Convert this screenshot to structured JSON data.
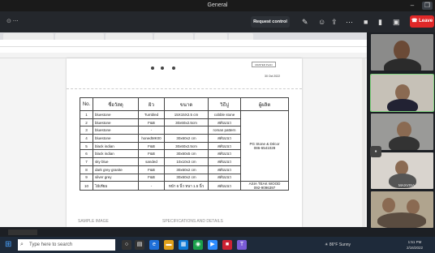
{
  "window": {
    "title": "General"
  },
  "meeting_bar": {
    "left_label": "",
    "request_control": "Request control",
    "leave": "Leave"
  },
  "browser": {
    "tabs": [
      "",
      "",
      "",
      "",
      "",
      ""
    ],
    "url": "",
    "bookmarks": ""
  },
  "pdf": {
    "zoom": "",
    "tools": "",
    "plan_mark": "MASTER PLAN",
    "stamp": "",
    "date": "30 Oct 2022",
    "footer_left": "SAMPLE IMAGE",
    "footer_right": "SPECIFICATIONS AND DETAILS"
  },
  "table": {
    "headers": [
      "No.",
      "ชื่อวัสดุ",
      "ผิว",
      "ขนาด",
      "วิธีปู",
      "ผู้ผลิต"
    ],
    "rows": [
      [
        "1",
        "bluestone",
        "Tumbled",
        "15X15X2.5 cm",
        "cobble stone"
      ],
      [
        "2",
        "bluestone",
        "F&B",
        "30x60x2.5cm",
        "สลับแนว"
      ],
      [
        "3",
        "bluestone",
        "-",
        "",
        "roman pattern"
      ],
      [
        "4",
        "bluestone",
        "honedMK00",
        "30x60x2 cm",
        "สลับแนว"
      ],
      [
        "5",
        "black indian",
        "F&B",
        "30x60x2.5cm",
        "สลับแนว"
      ],
      [
        "6",
        "black indian",
        "F&B",
        "30x60x5 cm",
        "สลับแนว"
      ],
      [
        "7",
        "sky blue",
        "sanded",
        "10x10x3 cm",
        "สลับแนว"
      ],
      [
        "8",
        "dark grey granite",
        "F&B",
        "30x60x2 cm",
        "สลับแนว"
      ],
      [
        "9",
        "silver grey",
        "F&B",
        "30x60x2 cm",
        "สลับแนว"
      ],
      [
        "10",
        "ไม้เทียม",
        "-",
        "หน้า 6 นิ้ว หนา 1.5 นิ้ว",
        "สลับแนว"
      ]
    ],
    "supplier_1": "PG Stone & Décor",
    "supplier_1_phone": "086-6541028",
    "supplier_2": "ASIA TEAK WOOD",
    "supplier_2_phone": "092-9096397"
  },
  "participants": {
    "names": [
      "",
      "",
      "",
      "MAXVISA",
      "",
      ""
    ]
  },
  "self_label": "MAXVISA",
  "taskbar": {
    "search_placeholder": "Type here to search",
    "tray": "",
    "weather": "86°F Sunny",
    "time": "1:51 PM",
    "date": "2/16/2022"
  },
  "colors": {
    "leave": "#e02828",
    "accent": "#4aa3ff",
    "active_border": "#7fd37f"
  }
}
